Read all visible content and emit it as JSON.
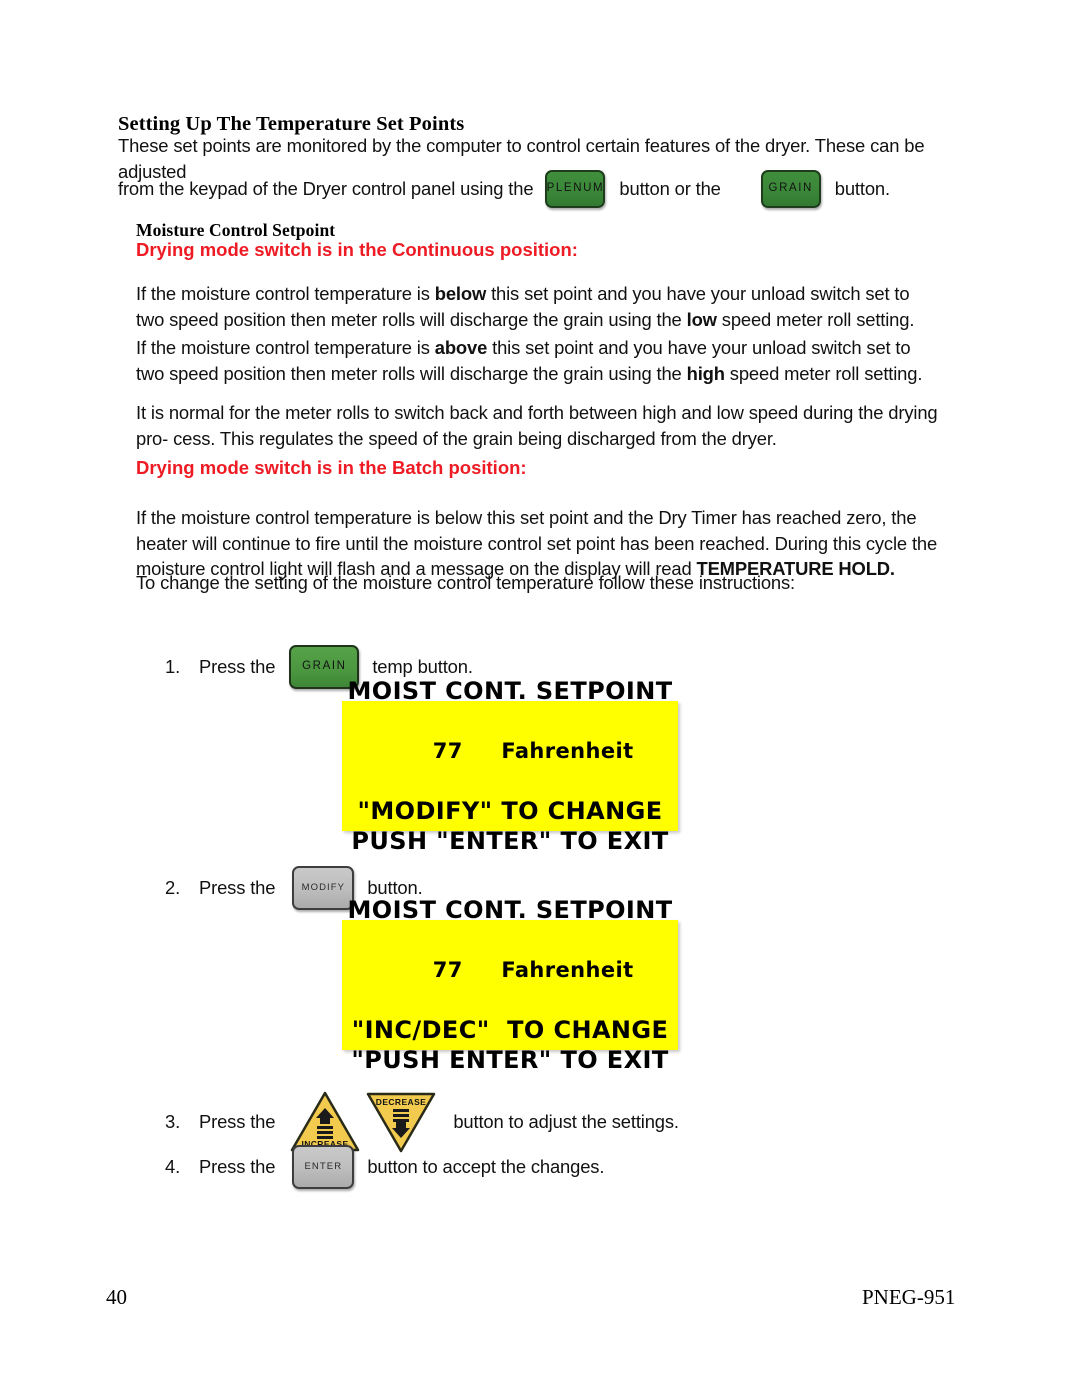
{
  "document": {
    "section_title": "Setting Up The Temperature Set Points",
    "intro_line1": "These set points are monitored by the computer to control certain features of the dryer.  These can be adjusted",
    "intro_line2_pre": "from the keypad of the Dryer control panel using the",
    "intro_line2_mid": "button or the",
    "intro_line2_post": "button.",
    "subsection_title": "Moisture Control Setpoint",
    "red_heading_continuous": "Drying mode switch is in the Continuous position:",
    "red_heading_batch": "Drying mode switch is in the Batch position:",
    "para_below_1": "If the moisture control temperature is ",
    "para_below_bold": "below",
    "para_below_2": " this set point and you have your unload switch set to two speed",
    "para_below_3": "position then meter rolls will discharge the grain using the ",
    "para_below_bold2": "low",
    "para_below_4": " speed meter roll setting.",
    "para_above_1": "If the moisture control temperature is ",
    "para_above_bold": "above",
    "para_above_2": " this set point and you have your unload switch set to two speed",
    "para_above_3": "position then meter rolls will discharge the grain using the ",
    "para_above_bold2": "high",
    "para_above_4": " speed meter roll setting.",
    "para_normal_1": "It is normal for the meter rolls to switch back and forth between high and low speed during the drying pro-",
    "para_normal_2": "cess.  This regulates the speed of the grain being discharged from the dryer.",
    "para_batch_1": "If the moisture control temperature is below this set point and the Dry Timer has reached zero, the heater will",
    "para_batch_2": "continue to fire until the moisture control set point has been reached.  During this cycle the moisture control",
    "para_batch_3": "light will flash and a message on the display will read ",
    "para_batch_bold": "TEMPERATURE HOLD.",
    "para_change_intro": "To change the setting of the moisture control temperature follow these instructions:"
  },
  "buttons": {
    "plenum": "PLENUM",
    "grain": "GRAIN",
    "grain_step": "GRAIN",
    "modify": "MODIFY",
    "enter": "ENTER",
    "increase": "INCREASE",
    "decrease": "DECREASE"
  },
  "steps": [
    {
      "num": "1.",
      "pre": "Press the",
      "post": "temp button.",
      "button": "GRAIN"
    },
    {
      "num": "2.",
      "pre": "Press the",
      "post": "button.",
      "button": "MODIFY"
    },
    {
      "num": "3.",
      "pre": "Press the",
      "post": "button to adjust the settings.",
      "button": "INCREASE/DECREASE"
    },
    {
      "num": "4.",
      "pre": "Press the",
      "post": "button to accept the changes.",
      "button": "ENTER"
    }
  ],
  "displays": [
    {
      "line1": "MOIST CONT. SETPOINT",
      "value": "77",
      "unit": "Fahrenheit",
      "line3": "\"MODIFY\" TO CHANGE",
      "line4": "PUSH \"ENTER\" TO EXIT"
    },
    {
      "line1": "MOIST CONT. SETPOINT",
      "value": "77",
      "unit": "Fahrenheit",
      "line3": "\"INC/DEC\"  TO CHANGE",
      "line4": "\"PUSH ENTER\" TO EXIT"
    }
  ],
  "footer": {
    "page_number": "40",
    "doc_code": "PNEG-951"
  },
  "colors": {
    "red_heading": "#ee1b24",
    "lcd_background": "#ffff00",
    "button_green": "#3b8739",
    "button_green_bright": "#4b9740",
    "button_gray": "#bdbdbd",
    "triangle_yellow": "#f2cb4e"
  }
}
